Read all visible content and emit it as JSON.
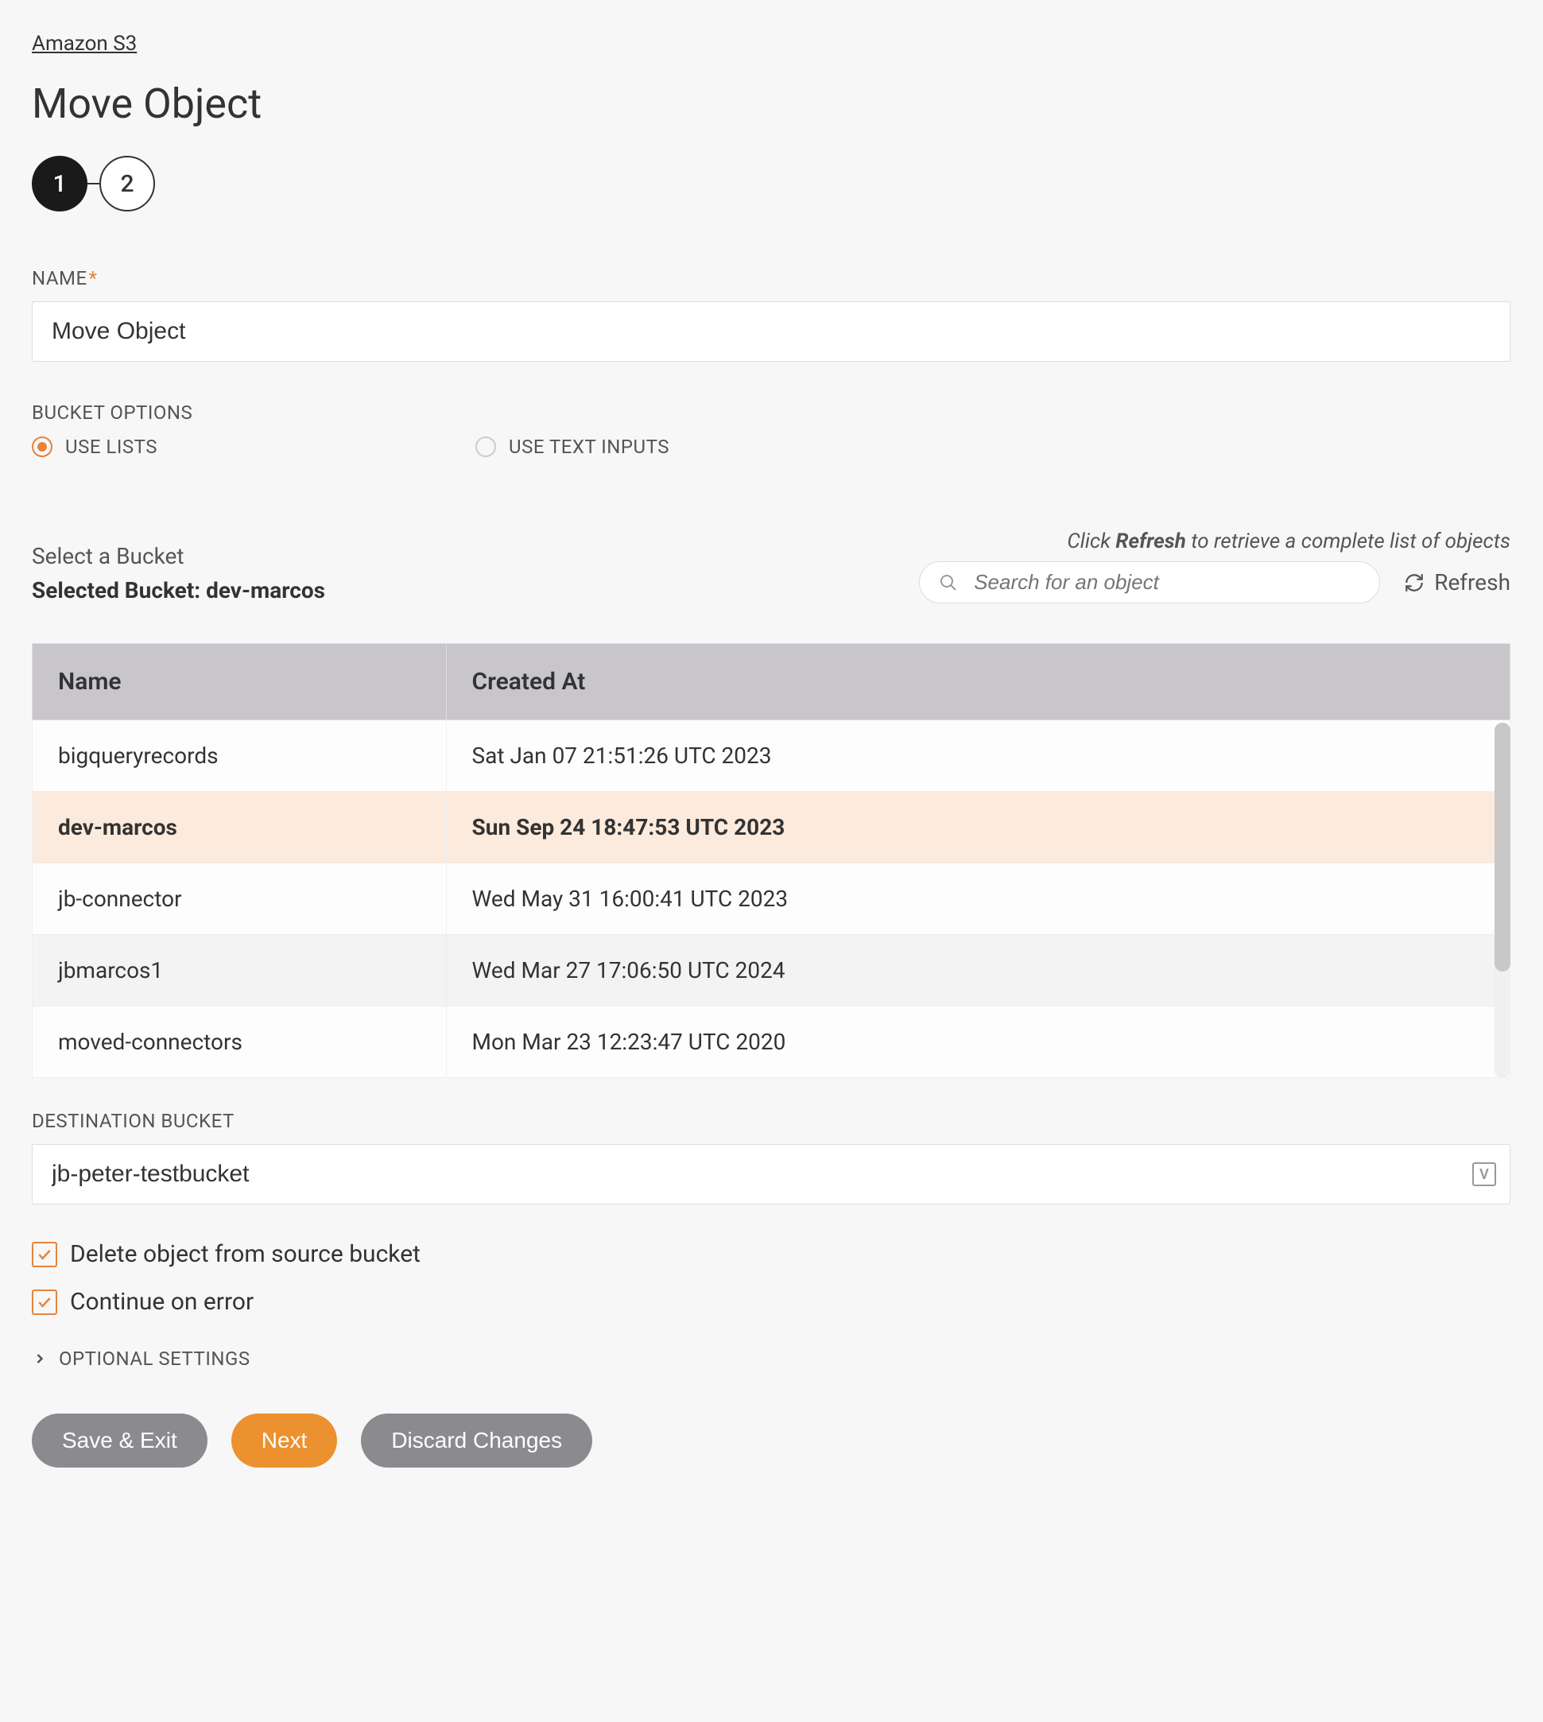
{
  "breadcrumb": "Amazon S3",
  "page_title": "Move Object",
  "stepper": {
    "step1": "1",
    "step2": "2"
  },
  "fields": {
    "name_label": "NAME",
    "name_value": "Move Object",
    "bucket_options_label": "BUCKET OPTIONS",
    "use_lists_label": "USE LISTS",
    "use_text_inputs_label": "USE TEXT INPUTS",
    "select_bucket_label": "Select a Bucket",
    "selected_bucket_prefix": "Selected Bucket: ",
    "selected_bucket_name": "dev-marcos",
    "refresh_hint_pre": "Click ",
    "refresh_hint_bold": "Refresh",
    "refresh_hint_post": " to retrieve a complete list of objects",
    "search_placeholder": "Search for an object",
    "refresh_button": "Refresh",
    "destination_bucket_label": "DESTINATION BUCKET",
    "destination_bucket_value": "jb-peter-testbucket",
    "delete_source_label": "Delete object from source bucket",
    "continue_on_error_label": "Continue on error",
    "optional_settings_label": "OPTIONAL SETTINGS",
    "var_badge": "V"
  },
  "table": {
    "col_name": "Name",
    "col_created": "Created At",
    "rows": [
      {
        "name": "bigqueryrecords",
        "created": "Sat Jan 07 21:51:26 UTC 2023",
        "selected": false
      },
      {
        "name": "dev-marcos",
        "created": "Sun Sep 24 18:47:53 UTC 2023",
        "selected": true
      },
      {
        "name": "jb-connector",
        "created": "Wed May 31 16:00:41 UTC 2023",
        "selected": false
      },
      {
        "name": "jbmarcos1",
        "created": "Wed Mar 27 17:06:50 UTC 2024",
        "selected": false
      },
      {
        "name": "moved-connectors",
        "created": "Mon Mar 23 12:23:47 UTC 2020",
        "selected": false
      }
    ]
  },
  "buttons": {
    "save_exit": "Save & Exit",
    "next": "Next",
    "discard": "Discard Changes"
  }
}
